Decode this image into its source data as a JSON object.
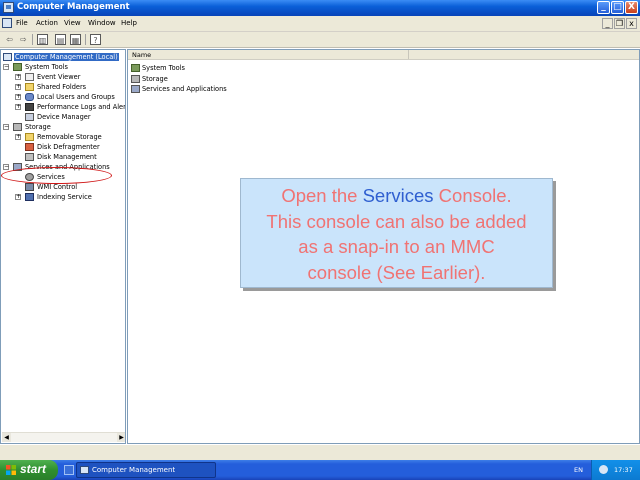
{
  "window": {
    "title": "Computer Management",
    "controls": {
      "minimize": "_",
      "maximize": "□",
      "close": "X"
    }
  },
  "menu": {
    "items": [
      "File",
      "Action",
      "View",
      "Window",
      "Help"
    ]
  },
  "toolbar": {
    "icons": [
      "back-arrow-icon",
      "forward-arrow-icon",
      "up-folder-icon",
      "show-hide-tree-icon",
      "export-list-icon",
      "properties-icon",
      "help-icon"
    ]
  },
  "tree": {
    "root": "Computer Management (Local)",
    "system_tools": {
      "label": "System Tools",
      "children": [
        "Event Viewer",
        "Shared Folders",
        "Local Users and Groups",
        "Performance Logs and Alerts",
        "Device Manager"
      ]
    },
    "storage": {
      "label": "Storage",
      "children": [
        "Removable Storage",
        "Disk Defragmenter",
        "Disk Management"
      ]
    },
    "services_apps": {
      "label": "Services and Applications",
      "children": [
        "Services",
        "WMI Control",
        "Indexing Service"
      ]
    }
  },
  "list": {
    "column_name": "Name",
    "items": [
      "System Tools",
      "Storage",
      "Services and Applications"
    ]
  },
  "callout": {
    "prefix": "Open the ",
    "highlight": "Services",
    "suffix": " Console.",
    "line2": "This console can also be added",
    "line3": "as a snap-in to an MMC",
    "line4": "console (See Earlier).",
    "text_color": "#f07373",
    "highlight_color": "#2f5fd0",
    "background": "#cae4fb"
  },
  "taskbar": {
    "start_label": "start",
    "task_button": "Computer Management",
    "language": "EN",
    "clock": "17:37"
  }
}
